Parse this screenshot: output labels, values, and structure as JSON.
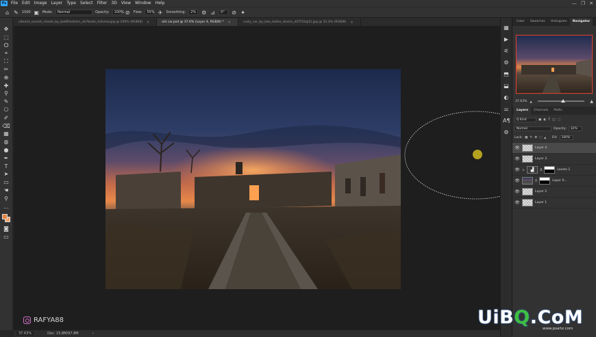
{
  "menubar": {
    "logo": "Ps",
    "items": [
      "File",
      "Edit",
      "Image",
      "Layer",
      "Type",
      "Select",
      "Filter",
      "3D",
      "View",
      "Window",
      "Help"
    ],
    "window_controls": [
      "—",
      "❐",
      "✕"
    ]
  },
  "options": {
    "brush_size": "1000",
    "mode_label": "Mode:",
    "mode_value": "Normal",
    "opacity_label": "Opacity:",
    "opacity_value": "100%",
    "flow_label": "Flow:",
    "flow_value": "55%",
    "smoothing_label": "Smoothing:",
    "smoothing_value": "2%",
    "angle_value": "0°"
  },
  "tabs": [
    {
      "label": "vibrant_sunset_clouds_by_boldfrontiers_da7be4e_fullview.jpg @ 100% (RGB/8)"
    },
    {
      "label": "old car.psd @ 37.6% (Layer 4, RGB/8) *"
    },
    {
      "label": "rusty_car_by_two_ladies_stocks_d1f742q(2).jpg @ 33.3% (RGB/8)"
    }
  ],
  "tools": [
    "✥",
    "⬚",
    "ⵔ",
    "⌖",
    "⛶",
    "✂",
    "⊕",
    "✚",
    "⚲",
    "✎",
    "⎔",
    "✐",
    "⌫",
    "▦",
    "◍",
    "●",
    "✒",
    "T",
    "➤",
    "▭",
    "☚",
    "⚲",
    "…"
  ],
  "status": {
    "zoom": "37.63%",
    "doc": "Doc: 15.8M/97.8M",
    "arrow": "›"
  },
  "strip_icons": [
    "▦",
    "▶",
    "⚟",
    "⚙",
    "⬒",
    "⬓",
    "◐",
    "⚌",
    "A¶",
    "⚙"
  ],
  "panel": {
    "top_tabs": [
      "Color",
      "Swatches",
      "Histogram",
      "Navigator"
    ],
    "nav_zoom": "37.63%",
    "nav_zoom_out": "▲",
    "nav_zoom_in": "▲",
    "layer_tabs": [
      "Layers",
      "Channels",
      "Paths"
    ],
    "kind_label": "Q Kind",
    "blend_mode": "Normal",
    "opacity_label": "Opacity:",
    "opacity_value": "32%",
    "lock_label": "Lock:",
    "fill_label": "Fill:",
    "fill_value": "100%",
    "layers": [
      {
        "name": "Layer 4",
        "selected": true,
        "thumb": "checker"
      },
      {
        "name": "Layer 3",
        "selected": false,
        "thumb": "checker"
      },
      {
        "name": "Levels 1",
        "selected": false,
        "thumb": "adj"
      },
      {
        "name": "Layer 0...",
        "selected": false,
        "thumb": "photo"
      },
      {
        "name": "Layer 2",
        "selected": false,
        "thumb": "checker"
      },
      {
        "name": "Layer 1",
        "selected": false,
        "thumb": "checker"
      }
    ]
  },
  "watermark": {
    "user": "RAFYA88",
    "site_main_a": "UiB",
    "site_accent": "Q",
    "site_main_b": ".CoM",
    "site_sub": "www.psahz.com"
  },
  "colors": {
    "foreground": "#e3853f",
    "background": "#f4a165",
    "brush_dot": "#b5a120"
  }
}
